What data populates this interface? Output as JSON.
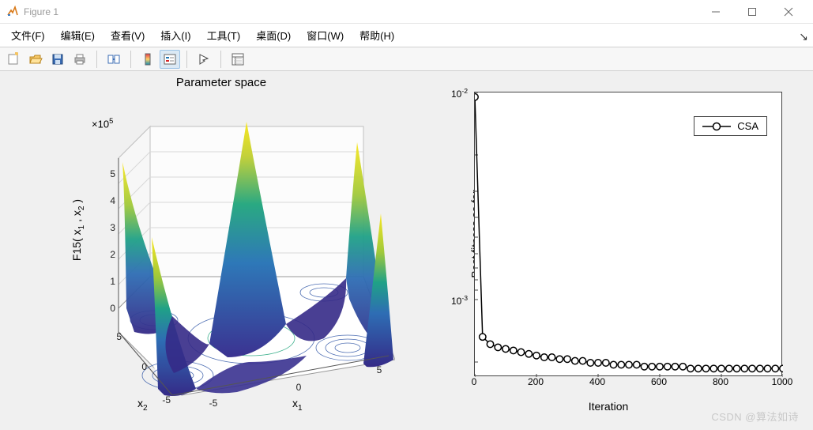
{
  "window": {
    "title": "Figure 1"
  },
  "menu": [
    "文件(F)",
    "编辑(E)",
    "查看(V)",
    "插入(I)",
    "工具(T)",
    "桌面(D)",
    "窗口(W)",
    "帮助(H)"
  ],
  "toolbar_icons": [
    "new-figure-icon",
    "open-icon",
    "save-icon",
    "print-icon",
    "|",
    "link-axes-icon",
    "|",
    "insert-colorbar-icon",
    "insert-legend-icon",
    "|",
    "cursor-icon",
    "|",
    "plot-tools-icon"
  ],
  "left_axes": {
    "title": "Parameter space",
    "zlabel_plain": "F15( x1 , x2 )",
    "z_mult_plain": "×10^5",
    "xlabel_plain": "x1",
    "ylabel_plain": "x2",
    "xticks": [
      "-5",
      "0",
      "5"
    ],
    "yticks": [
      "-5",
      "0",
      "5"
    ],
    "zticks": [
      "0",
      "1",
      "2",
      "3",
      "4",
      "5"
    ]
  },
  "right_axes": {
    "xlabel": "Iteration",
    "ylabel": "Best fitness so far",
    "xticks": [
      "0",
      "200",
      "400",
      "600",
      "800",
      "1000"
    ],
    "ytick_top_plain": "10^-2",
    "ytick_bottom_plain": "10^-3",
    "legend": "CSA"
  },
  "watermark": "CSDN @算法如诗",
  "chart_data": [
    {
      "type": "surface",
      "title": "Parameter space",
      "xlabel": "x1",
      "ylabel": "x2",
      "zlabel": "F15(x1,x2)",
      "xlim": [
        -5,
        5
      ],
      "ylim": [
        -5,
        5
      ],
      "zlim": [
        0,
        500000
      ],
      "colormap": "parula",
      "description": "3D surface of benchmark function F15 over x1,x2 in [-5,5]; four corner peaks near 5e5 and a central peak, valleys between them; contour projection drawn on base plane."
    },
    {
      "type": "line",
      "title": "",
      "xlabel": "Iteration",
      "ylabel": "Best fitness so far",
      "xlim": [
        0,
        1000
      ],
      "ylim": [
        0.0004,
        0.01
      ],
      "yscale": "log",
      "legend_position": "northeast",
      "series": [
        {
          "name": "CSA",
          "marker": "o",
          "color": "#000000",
          "x": [
            0,
            25,
            50,
            75,
            100,
            125,
            150,
            175,
            200,
            225,
            250,
            275,
            300,
            325,
            350,
            375,
            400,
            425,
            450,
            475,
            500,
            525,
            550,
            575,
            600,
            625,
            650,
            675,
            700,
            725,
            750,
            775,
            800,
            825,
            850,
            875,
            900,
            925,
            950,
            975,
            1000
          ],
          "y": [
            0.0095,
            0.00063,
            0.00058,
            0.00056,
            0.00055,
            0.00054,
            0.00053,
            0.00052,
            0.00051,
            0.0005,
            0.0005,
            0.00049,
            0.00049,
            0.00048,
            0.00048,
            0.00047,
            0.00047,
            0.00047,
            0.00046,
            0.00046,
            0.00046,
            0.00046,
            0.00045,
            0.00045,
            0.00045,
            0.00045,
            0.00045,
            0.00045,
            0.00044,
            0.00044,
            0.00044,
            0.00044,
            0.00044,
            0.00044,
            0.00044,
            0.00044,
            0.00044,
            0.00044,
            0.00044,
            0.00044,
            0.00044
          ]
        }
      ]
    }
  ]
}
